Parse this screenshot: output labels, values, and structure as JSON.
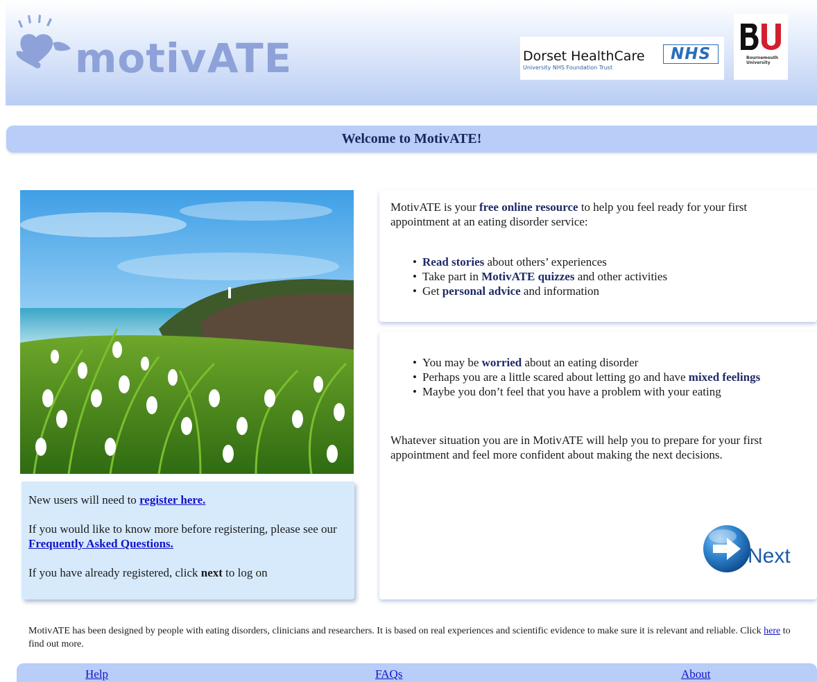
{
  "header": {
    "logo_text": "motivATE",
    "partner1_name": "Dorset HealthCare",
    "partner1_sub": "University NHS Foundation Trust",
    "partner1_badge": "NHS",
    "partner2_letters": "BU",
    "partner2_sub_line1": "Bournemouth",
    "partner2_sub_line2": "University"
  },
  "welcome": "Welcome to MotivATE!",
  "info_box": {
    "line1_prefix": "New users will need to ",
    "register_link": "register here.",
    "line2_prefix": "If you would like to know more before registering, please see our ",
    "faq_link": "Frequently Asked Questions.",
    "line3_prefix": "If you have already registered, click ",
    "line3_bold": "next",
    "line3_suffix": " to log on"
  },
  "panel1": {
    "intro_a": "MotivATE is your ",
    "intro_bold": "free online resource",
    "intro_b": " to help you feel ready for your first appointment at an eating disorder service:",
    "bullets": [
      {
        "bold": "Read stories",
        "text": " about others’ experiences",
        "pre": ""
      },
      {
        "pre": "Take part in ",
        "bold": "MotivATE quizzes",
        "text": " and other activities"
      },
      {
        "pre": "Get ",
        "bold": "personal advice",
        "text": " and information"
      }
    ]
  },
  "panel2": {
    "bullets": [
      {
        "pre": "You may be ",
        "bold": "worried",
        "text": " about an eating disorder"
      },
      {
        "pre": "Perhaps you are a little scared about letting go and have ",
        "bold": "mixed feelings",
        "text": ""
      },
      {
        "pre": "Maybe you don’t feel that you have a problem with your eating",
        "bold": "",
        "text": ""
      }
    ],
    "closing": "Whatever situation you are in MotivATE will help you to prepare for your first appointment and feel more confident about making the next decisions."
  },
  "next_label": "Next",
  "footer": {
    "text_a": "MotivATE has been designed by people with eating disorders, clinicians and researchers. It is based on real experiences and scientific evidence to make sure it is relevant and reliable. Click ",
    "link": "here",
    "text_b": " to find out more."
  },
  "nav": {
    "help": "Help",
    "faqs": "FAQs",
    "about": "About"
  },
  "colors": {
    "bar": "#b8cdf7",
    "link": "#1414c8",
    "logo": "#8ea2d9",
    "info_bg": "#d7eafc"
  },
  "icons": {
    "logo_mark": "hand-heart-icon",
    "next": "arrow-right-circle-icon"
  }
}
